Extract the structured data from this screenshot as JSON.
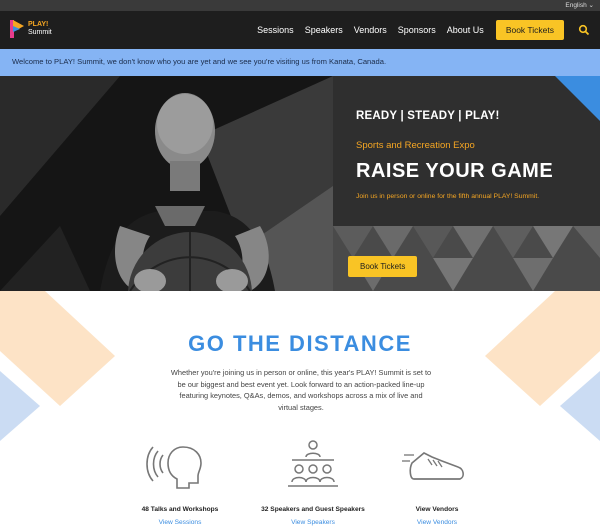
{
  "topbar": {
    "language": "English ⌄"
  },
  "nav": {
    "logo_line1": "PLAY!",
    "logo_line2": "Summit",
    "items": [
      "Sessions",
      "Speakers",
      "Vendors",
      "Sponsors",
      "About Us"
    ],
    "book_label": "Book Tickets"
  },
  "banner": {
    "text": "Welcome to PLAY! Summit, we don't know who you are yet and we see you're visiting us from Kanata, Canada."
  },
  "hero": {
    "title": "READY | STEADY | PLAY!",
    "subtitle": "Sports and Recreation Expo",
    "headline": "RAISE YOUR GAME",
    "description": "Join us in person or online for the fifth annual PLAY! Summit.",
    "button_label": "Book Tickets"
  },
  "section": {
    "title": "GO THE DISTANCE",
    "text": "Whether you're joining us in person or online, this year's PLAY! Summit is set to be our biggest and best event yet. Look forward to an action-packed line-up featuring keynotes, Q&As, demos, and workshops across a mix of live and virtual stages."
  },
  "features": [
    {
      "title": "48 Talks and Workshops",
      "link": "View Sessions",
      "icon": "talk-icon"
    },
    {
      "title": "32 Speakers and Guest Speakers",
      "link": "View Speakers",
      "icon": "audience-icon"
    },
    {
      "title": "View Vendors",
      "link": "View Vendors",
      "icon": "sneaker-icon"
    }
  ],
  "colors": {
    "accent_blue": "#3b8de0",
    "accent_yellow": "#f9c425",
    "accent_orange": "#f5a623",
    "banner": "#85b4f4"
  }
}
